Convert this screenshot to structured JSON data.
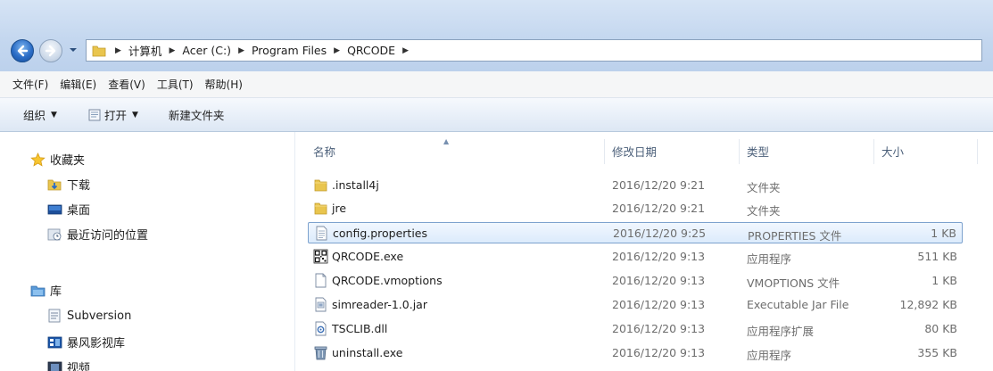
{
  "address": {
    "crumbs": [
      "计算机",
      "Acer (C:)",
      "Program Files",
      "QRCODE"
    ]
  },
  "menu": [
    "文件(F)",
    "编辑(E)",
    "查看(V)",
    "工具(T)",
    "帮助(H)"
  ],
  "toolbar": {
    "organize": "组织",
    "open": "打开",
    "new_folder": "新建文件夹"
  },
  "nav": {
    "favorites": "收藏夹",
    "downloads": "下载",
    "desktop": "桌面",
    "recent": "最近访问的位置",
    "libraries": "库",
    "subversion": "Subversion",
    "baofeng": "暴风影视库",
    "videos": "视频"
  },
  "columns": {
    "name": "名称",
    "date": "修改日期",
    "type": "类型",
    "size": "大小"
  },
  "files": [
    {
      "name": ".install4j",
      "date": "2016/12/20 9:21",
      "type": "文件夹",
      "size": "",
      "icon": "folder-icon"
    },
    {
      "name": "jre",
      "date": "2016/12/20 9:21",
      "type": "文件夹",
      "size": "",
      "icon": "folder-icon"
    },
    {
      "name": "config.properties",
      "date": "2016/12/20 9:25",
      "type": "PROPERTIES 文件",
      "size": "1 KB",
      "icon": "properties-file-icon",
      "selected": true
    },
    {
      "name": "QRCODE.exe",
      "date": "2016/12/20 9:13",
      "type": "应用程序",
      "size": "511 KB",
      "icon": "qrcode-exe-icon"
    },
    {
      "name": "QRCODE.vmoptions",
      "date": "2016/12/20 9:13",
      "type": "VMOPTIONS 文件",
      "size": "1 KB",
      "icon": "blank-file-icon"
    },
    {
      "name": "simreader-1.0.jar",
      "date": "2016/12/20 9:13",
      "type": "Executable Jar File",
      "size": "12,892 KB",
      "icon": "jar-file-icon"
    },
    {
      "name": "TSCLIB.dll",
      "date": "2016/12/20 9:13",
      "type": "应用程序扩展",
      "size": "80 KB",
      "icon": "dll-file-icon"
    },
    {
      "name": "uninstall.exe",
      "date": "2016/12/20 9:13",
      "type": "应用程序",
      "size": "355 KB",
      "icon": "uninstall-exe-icon"
    }
  ]
}
